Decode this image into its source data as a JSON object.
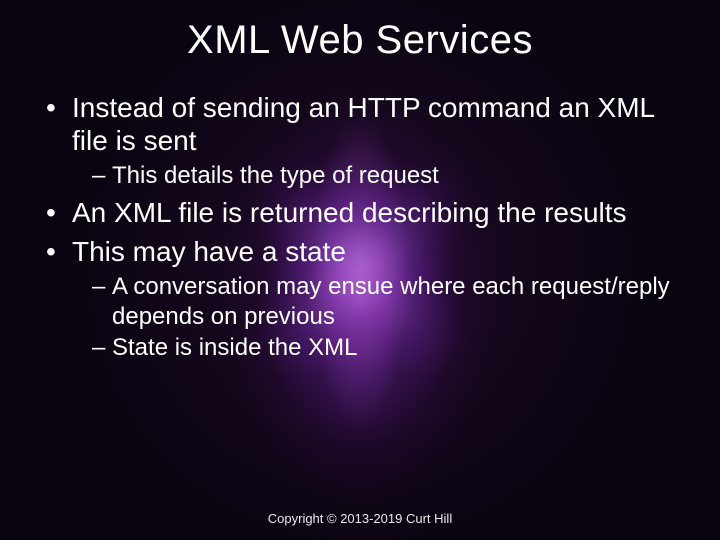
{
  "title": "XML Web Services",
  "bullets": [
    {
      "text": "Instead of sending an HTTP command an XML file is sent",
      "sub": [
        {
          "text": "This details the type of request"
        }
      ]
    },
    {
      "text": "An XML file is returned describing the results",
      "sub": []
    },
    {
      "text": "This may have a state",
      "sub": [
        {
          "text": "A conversation may ensue where each request/reply depends on previous"
        },
        {
          "text": "State is inside the XML"
        }
      ]
    }
  ],
  "footer": "Copyright © 2013-2019 Curt Hill"
}
